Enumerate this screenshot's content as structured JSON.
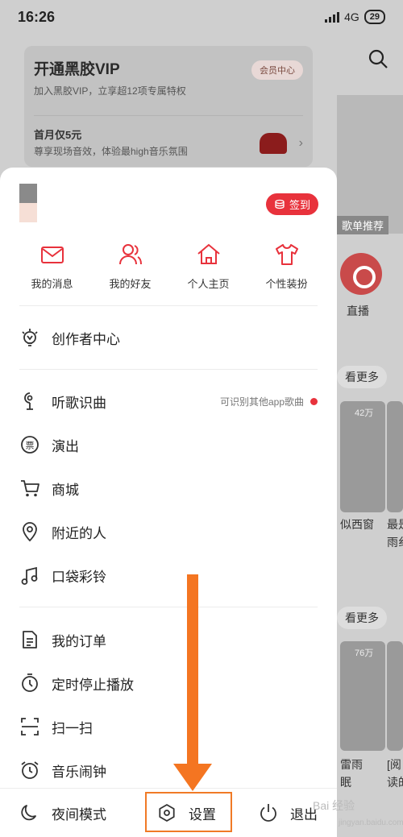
{
  "status_bar": {
    "time": "16:26",
    "network": "4G",
    "battery": "29"
  },
  "vip": {
    "title": "开通黑胶VIP",
    "subtitle": "加入黑胶VIP，立享超12项专属特权",
    "center_button": "会员中心",
    "offer": "首月仅5元",
    "offer_sub": "尊享现场音效，体验最high音乐氛围"
  },
  "background": {
    "banner_label": "歌单推荐",
    "live_label": "直播",
    "see_more_1": "看更多",
    "see_more_2": "看更多",
    "tiles": [
      {
        "count": "42万"
      },
      {
        "count": ""
      },
      {
        "count": "76万"
      },
      {
        "count": ""
      }
    ],
    "tile_texts": [
      "似西窗",
      "最是\n雨纟",
      "雷雨\n眠",
      "[阅\n读的"
    ]
  },
  "drawer": {
    "signin_label": "签到",
    "quick_actions": [
      {
        "label": "我的消息",
        "icon": "mail-icon"
      },
      {
        "label": "我的好友",
        "icon": "friends-icon"
      },
      {
        "label": "个人主页",
        "icon": "home-icon"
      },
      {
        "label": "个性装扮",
        "icon": "tshirt-icon"
      }
    ],
    "creator_center": "创作者中心",
    "menu_group_1": [
      {
        "label": "听歌识曲",
        "icon": "mic-icon",
        "hint": "可识别其他app歌曲"
      },
      {
        "label": "演出",
        "icon": "ticket-icon"
      },
      {
        "label": "商城",
        "icon": "cart-icon"
      },
      {
        "label": "附近的人",
        "icon": "location-icon"
      },
      {
        "label": "口袋彩铃",
        "icon": "ringtone-icon"
      }
    ],
    "menu_group_2": [
      {
        "label": "我的订单",
        "icon": "order-icon"
      },
      {
        "label": "定时停止播放",
        "icon": "timer-icon"
      },
      {
        "label": "扫一扫",
        "icon": "scan-icon"
      },
      {
        "label": "音乐闹钟",
        "icon": "alarm-icon"
      }
    ],
    "bottom_bar": {
      "night_mode": "夜间模式",
      "settings": "设置",
      "logout": "退出"
    }
  },
  "watermark": {
    "text": "Bai 经验",
    "url": "jingyan.baidu.com"
  }
}
